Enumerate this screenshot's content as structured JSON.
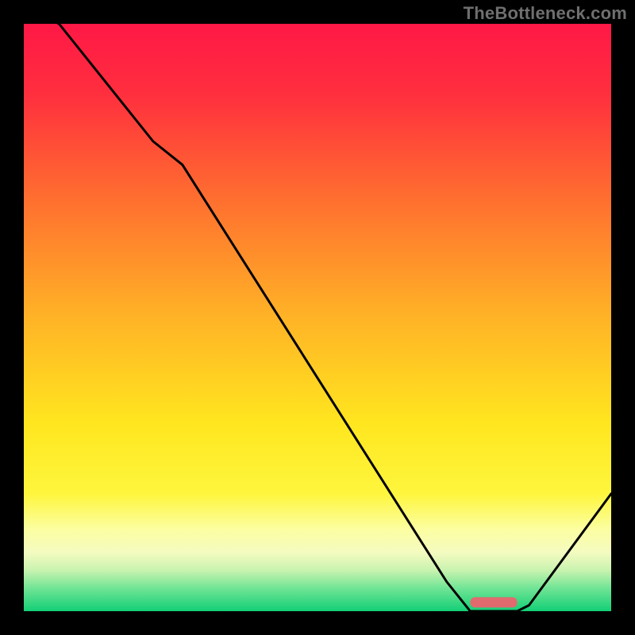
{
  "watermark": "TheBottleneck.com",
  "chart_data": {
    "type": "line",
    "title": "",
    "xlabel": "",
    "ylabel": "",
    "xlim": [
      0,
      100
    ],
    "ylim": [
      0,
      100
    ],
    "x": [
      0,
      6,
      22,
      27,
      72,
      76,
      84,
      86,
      100
    ],
    "y": [
      103,
      100,
      80,
      76,
      5,
      0,
      0,
      1,
      20
    ],
    "marker": {
      "x_start": 76,
      "x_end": 84,
      "y": 1.5,
      "color": "#e16a6e"
    },
    "gradient_stops": [
      {
        "pct": 0,
        "color": "#ff1846"
      },
      {
        "pct": 12,
        "color": "#ff2f3e"
      },
      {
        "pct": 30,
        "color": "#ff6f2f"
      },
      {
        "pct": 50,
        "color": "#ffb326"
      },
      {
        "pct": 68,
        "color": "#ffe61f"
      },
      {
        "pct": 80,
        "color": "#fef63d"
      },
      {
        "pct": 86,
        "color": "#fcfea0"
      },
      {
        "pct": 90,
        "color": "#f4fbc0"
      },
      {
        "pct": 93,
        "color": "#c9f3b0"
      },
      {
        "pct": 96,
        "color": "#73e596"
      },
      {
        "pct": 100,
        "color": "#13cf76"
      }
    ],
    "curve_color": "#000000",
    "curve_width": 3
  }
}
